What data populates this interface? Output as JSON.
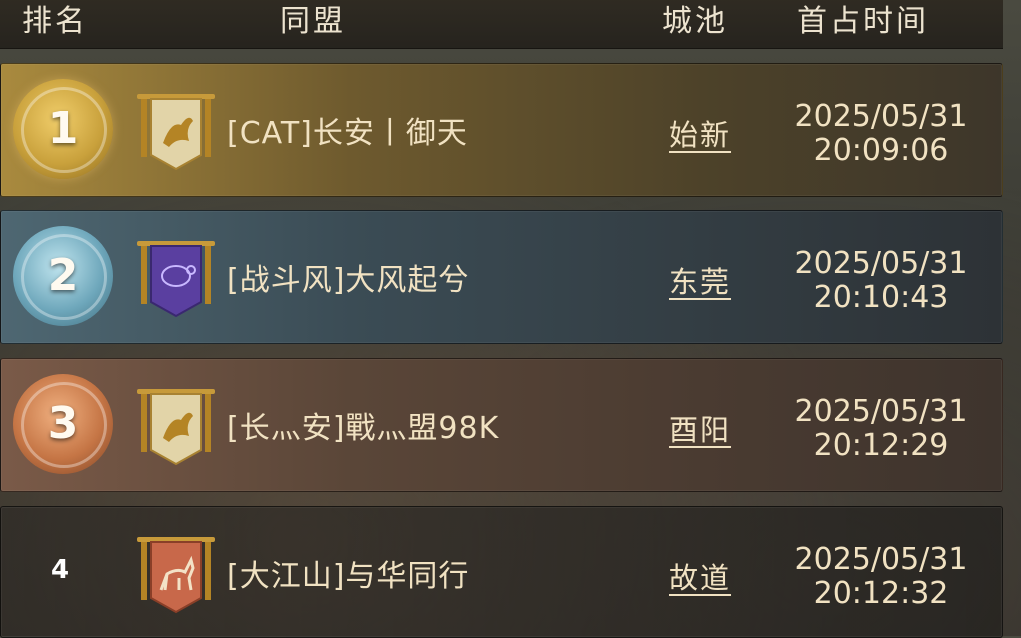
{
  "header": {
    "rank": "排名",
    "alliance": "同盟",
    "city": "城池",
    "first_time": "首占时间"
  },
  "rows": [
    {
      "rank": "1",
      "medal": "gold",
      "banner": {
        "icon": "qilin-banner-icon",
        "color": "#d9c48a"
      },
      "alliance": "[CAT]长安丨御天",
      "city": "始新",
      "date": "2025/05/31",
      "time": "20:09:06"
    },
    {
      "rank": "2",
      "medal": "silver",
      "banner": {
        "icon": "tortoise-banner-icon",
        "color": "#5a3fa0"
      },
      "alliance": "[战斗风]大风起兮",
      "city": "东莞",
      "date": "2025/05/31",
      "time": "20:10:43"
    },
    {
      "rank": "3",
      "medal": "bronze",
      "banner": {
        "icon": "qilin-banner-icon",
        "color": "#d9c48a"
      },
      "alliance": "[长灬安]戰灬盟98K",
      "city": "酉阳",
      "date": "2025/05/31",
      "time": "20:12:29"
    },
    {
      "rank": "4",
      "medal": "none",
      "banner": {
        "icon": "deer-banner-icon",
        "color": "#c8684a"
      },
      "alliance": "[大江山]与华同行",
      "city": "故道",
      "date": "2025/05/31",
      "time": "20:12:32"
    }
  ]
}
